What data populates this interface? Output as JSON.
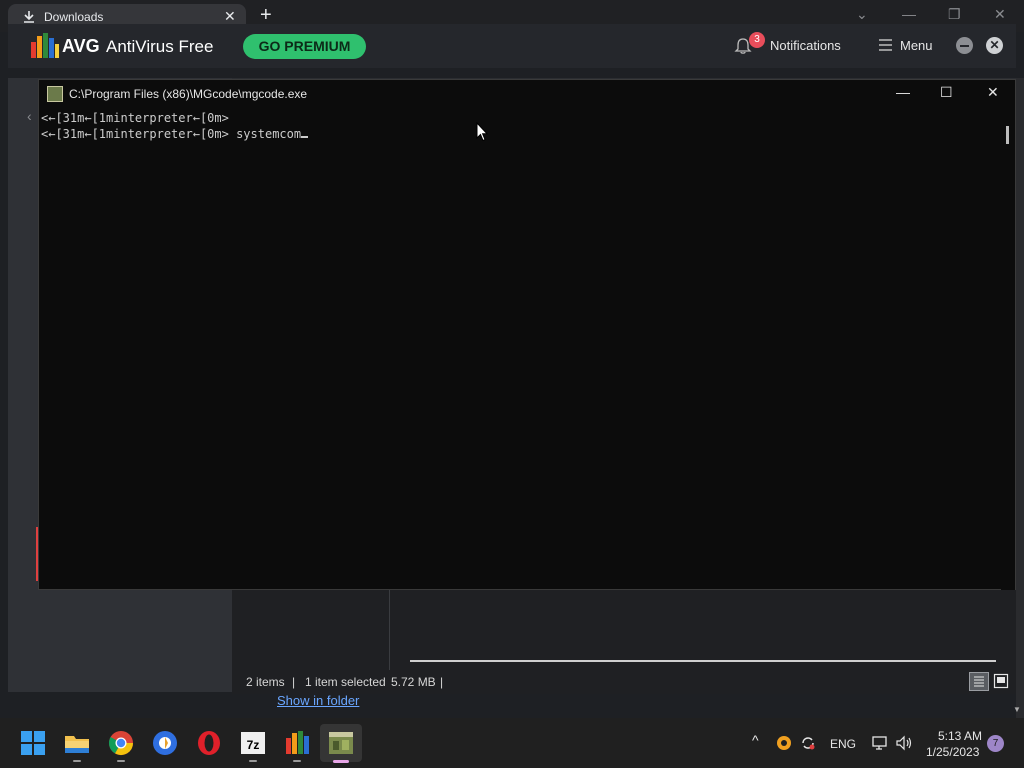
{
  "browser": {
    "tab_title": "Downloads",
    "tab_close": "✕",
    "new_tab": "+",
    "controls": {
      "dropdown": "⌄",
      "minimize": "—",
      "restore": "❐",
      "close": "✕"
    }
  },
  "avg": {
    "brand": "AVG",
    "product": "AntiVirus Free",
    "premium_label": "GO PREMIUM",
    "notifications_count": "3",
    "notifications_label": "Notifications",
    "menu_label": "Menu",
    "close_glyph": "✕"
  },
  "console": {
    "title": "C:\\Program Files (x86)\\MGcode\\mgcode.exe",
    "controls": {
      "minimize": "—",
      "maximize": "☐",
      "close": "✕"
    },
    "lines": [
      "<←[31m←[1minterpreter←[0m>",
      "<←[31m←[1minterpreter←[0m> systemcom"
    ]
  },
  "explorer": {
    "nav_arrow": "‹",
    "status_items": "2 items",
    "status_sep1": "|",
    "status_selected": "1 item selected",
    "status_size": "5.72 MB",
    "status_sep2": "|",
    "show_in_folder": "Show in folder",
    "scroll_down": "▼"
  },
  "taskbar": {
    "apps": [
      "start-icon",
      "file-explorer-icon",
      "chrome-icon",
      "browser-icon",
      "opera-icon",
      "7zip-icon",
      "avg-icon",
      "mgcode-icon"
    ],
    "tray_chevron": "^",
    "lang": "ENG",
    "time": "5:13 AM",
    "date": "1/25/2023",
    "notification_count": "7"
  },
  "colors": {
    "avg_premium": "#2fc06e",
    "notif_badge": "#e84d5b",
    "console_bg": "#0c0c0c",
    "taskbar_bg": "#202020"
  }
}
